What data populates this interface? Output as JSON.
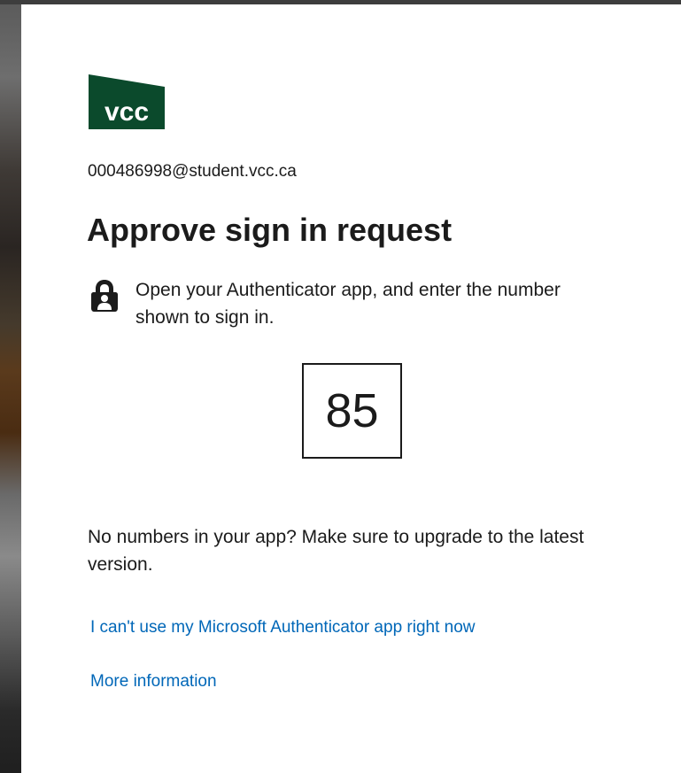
{
  "brand": {
    "logo_text": "vcc",
    "logo_color": "#0b4a2c"
  },
  "account": {
    "email": "000486998@student.vcc.ca"
  },
  "title": "Approve sign in request",
  "instruction": {
    "icon": "lock-person-icon",
    "text": "Open your Authenticator app, and enter the number shown to sign in."
  },
  "number": "85",
  "hint": "No numbers in your app? Make sure to upgrade to the latest version.",
  "links": {
    "cant_use": "I can't use my Microsoft Authenticator app right now",
    "more_info": "More information"
  },
  "colors": {
    "link": "#0067b8",
    "text": "#1b1b1b",
    "background": "#ffffff"
  }
}
